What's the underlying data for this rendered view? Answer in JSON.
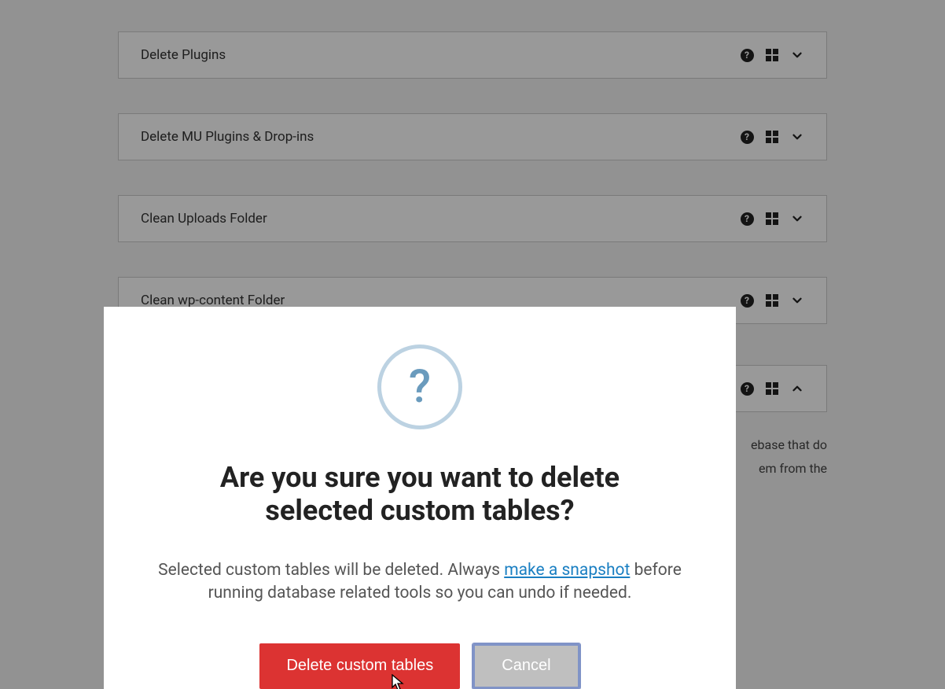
{
  "panels": [
    {
      "title": "Delete Plugins",
      "expanded": false
    },
    {
      "title": "Delete MU Plugins & Drop-ins",
      "expanded": false
    },
    {
      "title": "Clean Uploads Folder",
      "expanded": false
    },
    {
      "title": "Clean wp-content Folder",
      "expanded": false
    }
  ],
  "bg_partial": {
    "line1": "ebase that do",
    "line2": "em from the"
  },
  "modal": {
    "title": "Are you sure you want to delete selected custom tables?",
    "body_before": "Selected custom tables will be deleted. Always ",
    "link_text": "make a snapshot",
    "body_after": " before running database related tools so you can undo if needed.",
    "confirm_label": "Delete custom tables",
    "cancel_label": "Cancel"
  }
}
